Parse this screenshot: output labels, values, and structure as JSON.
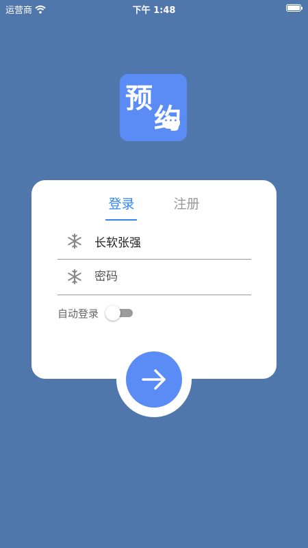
{
  "status_bar": {
    "carrier": "运营商",
    "time": "下午 1:48",
    "icons": [
      "wifi-icon",
      "battery-icon"
    ]
  },
  "logo": {
    "char1": "预",
    "char2": "约",
    "icon": "chat-bubble-icon"
  },
  "tabs": [
    {
      "label": "登录",
      "active": true
    },
    {
      "label": "注册",
      "active": false
    }
  ],
  "form": {
    "username_value": "长软张强",
    "password_placeholder": "密码",
    "field_icon": "snowflake-icon",
    "auto_login_label": "自动登录",
    "auto_login_on": false
  },
  "submit": {
    "icon": "arrow-right-icon"
  },
  "colors": {
    "background": "#5077AC",
    "accent": "#5B8CF5",
    "tab_active": "#2F86F0",
    "card": "#FFFFFF"
  }
}
